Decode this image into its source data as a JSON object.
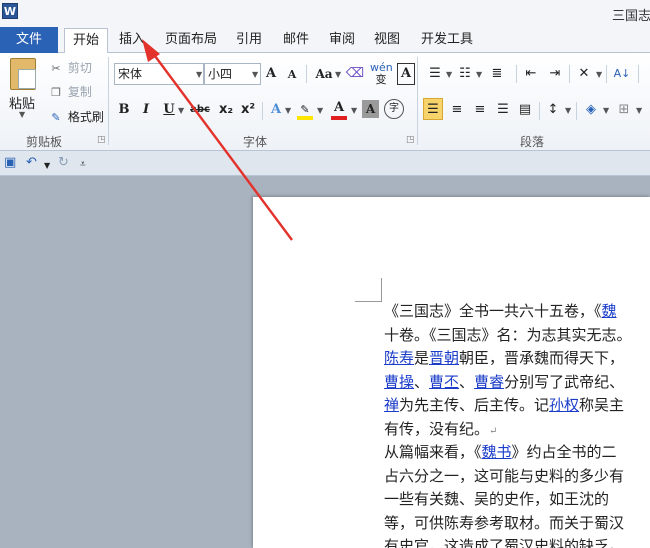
{
  "window": {
    "app_icon_letter": "W",
    "title": "三国志"
  },
  "tabs": {
    "file": "文件",
    "items": [
      "开始",
      "插入",
      "页面布局",
      "引用",
      "邮件",
      "审阅",
      "视图",
      "开发工具"
    ],
    "active": "开始"
  },
  "ribbon": {
    "clipboard": {
      "paste": "粘贴",
      "cut": "剪切",
      "copy": "复制",
      "format_painter": "格式刷",
      "label": "剪贴板"
    },
    "font": {
      "font_name": "宋体",
      "font_size": "小四",
      "grow": "A",
      "shrink": "A",
      "change_case": "Aa",
      "clear_format": "A",
      "phonetic": "wén",
      "char_border": "A",
      "bold": "B",
      "italic": "I",
      "underline": "U",
      "strike": "abc",
      "subscript": "x₂",
      "superscript": "x²",
      "text_effect": "A",
      "highlight": "ab",
      "font_color": "A",
      "char_shading": "A",
      "enclose": "字",
      "label": "字体"
    },
    "paragraph": {
      "sort": "A↓",
      "label": "段落"
    },
    "colors": {
      "file_tab": "#2a62b6",
      "highlight_yellow": "#ffe600",
      "font_red": "#e02020",
      "align_left_active": "#f6d36b"
    }
  },
  "document": {
    "lines": [
      [
        {
          "t": "《三国志》全书一共六十五卷，《"
        },
        {
          "t": "魏",
          "link": true
        }
      ],
      [
        {
          "t": "十卷。《三国志》名：为志其实无志。"
        }
      ],
      [
        {
          "t": "陈寿",
          "link": true
        },
        {
          "t": "是"
        },
        {
          "t": "晋朝",
          "link": true
        },
        {
          "t": "朝臣，晋承魏而得天下，"
        }
      ],
      [
        {
          "t": "曹操",
          "link": true
        },
        {
          "t": "、"
        },
        {
          "t": "曹丕",
          "link": true
        },
        {
          "t": "、"
        },
        {
          "t": "曹睿",
          "link": true
        },
        {
          "t": "分别写了武帝纪、"
        }
      ],
      [
        {
          "t": "禅",
          "link": true
        },
        {
          "t": "为先主传、后主传。记"
        },
        {
          "t": "孙权",
          "link": true
        },
        {
          "t": "称吴主"
        }
      ],
      [
        {
          "t": "有传，没有纪。"
        },
        {
          "t": "↵",
          "mark": true
        }
      ],
      [
        {
          "t": "从篇幅来看，《"
        },
        {
          "t": "魏书",
          "link": true
        },
        {
          "t": "》约占全书的二"
        }
      ],
      [
        {
          "t": "占六分之一，这可能与史料的多少有"
        }
      ],
      [
        {
          "t": "一些有关魏、吴的史作，如王沈的"
        }
      ],
      [
        {
          "t": "等，可供陈寿参考取材。而关于蜀汉"
        }
      ],
      [
        {
          "t": "有史官，这造成了蜀汉史料的缺乏。"
        }
      ]
    ]
  }
}
